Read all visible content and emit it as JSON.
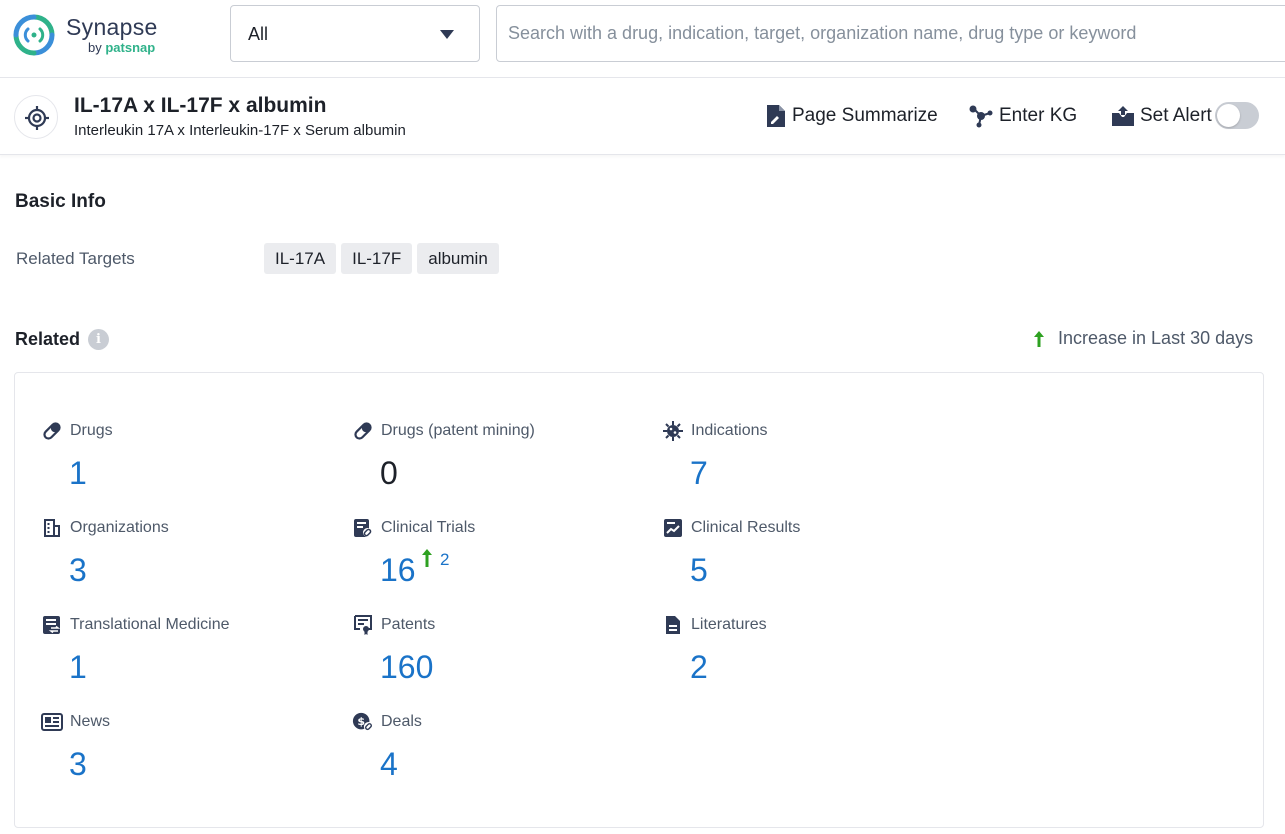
{
  "app": {
    "logo_name": "Synapse",
    "logo_by": "by",
    "logo_brand": "patsnap"
  },
  "search": {
    "scope": "All",
    "placeholder": "Search with a drug, indication, target, organization name, drug type or keyword"
  },
  "header": {
    "title": "IL-17A x IL-17F x albumin",
    "subtitle": "Interleukin 17A x Interleukin-17F x Serum albumin",
    "actions": {
      "summarize": "Page Summarize",
      "kg": "Enter KG",
      "alert": "Set Alert"
    },
    "alert_enabled": false
  },
  "basic_info": {
    "title": "Basic Info",
    "related_targets_label": "Related Targets",
    "tags": [
      "IL-17A",
      "IL-17F",
      "albumin"
    ]
  },
  "related": {
    "title": "Related",
    "legend": "Increase in Last 30 days",
    "colors": {
      "number": "#1a73c8",
      "increase": "#2ea121"
    },
    "stats": {
      "drugs": {
        "label": "Drugs",
        "value": "1",
        "icon": "pill-icon"
      },
      "drugs_patent": {
        "label": "Drugs (patent mining)",
        "value": "0",
        "icon": "pill-icon"
      },
      "indications": {
        "label": "Indications",
        "value": "7",
        "icon": "virus-icon"
      },
      "organizations": {
        "label": "Organizations",
        "value": "3",
        "icon": "building-icon"
      },
      "clinical_trials": {
        "label": "Clinical Trials",
        "value": "16",
        "increase": "2",
        "icon": "clinical-trial-icon"
      },
      "clinical_results": {
        "label": "Clinical Results",
        "value": "5",
        "icon": "chart-doc-icon"
      },
      "translational": {
        "label": "Translational Medicine",
        "value": "1",
        "icon": "translational-icon"
      },
      "patents": {
        "label": "Patents",
        "value": "160",
        "icon": "patent-icon"
      },
      "literatures": {
        "label": "Literatures",
        "value": "2",
        "icon": "document-icon"
      },
      "news": {
        "label": "News",
        "value": "3",
        "icon": "newspaper-icon"
      },
      "deals": {
        "label": "Deals",
        "value": "4",
        "icon": "deal-icon"
      }
    }
  }
}
